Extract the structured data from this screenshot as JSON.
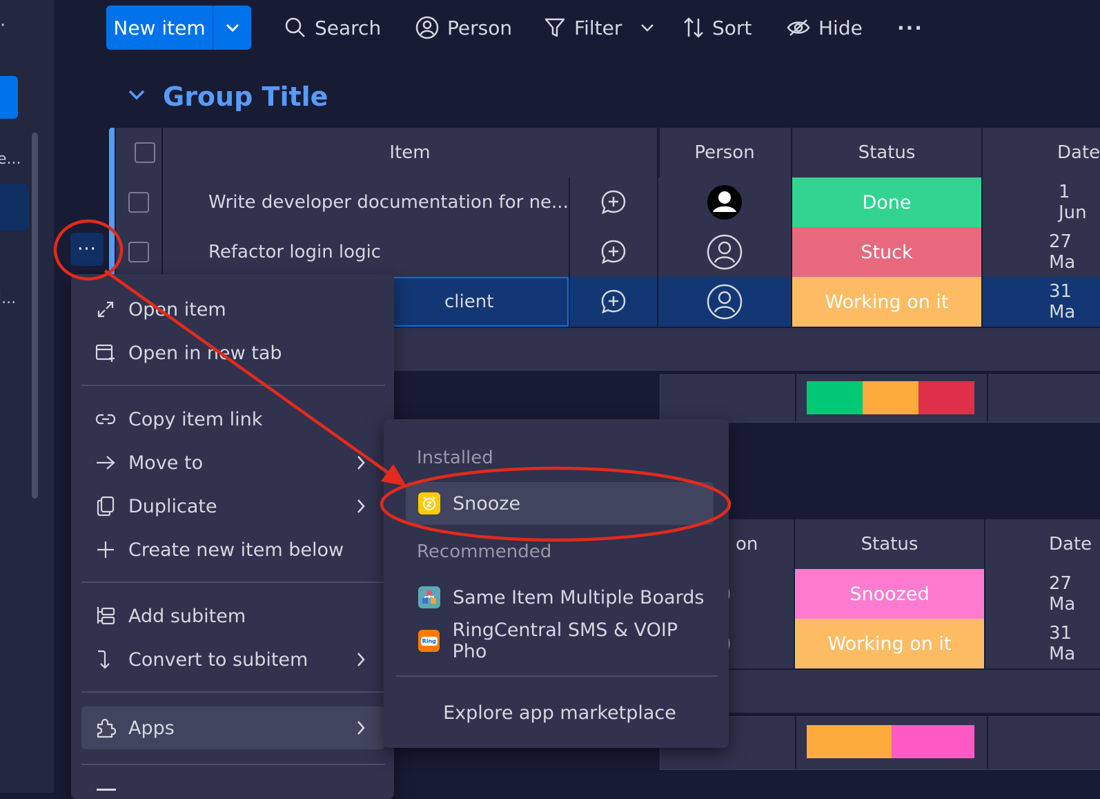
{
  "rail": {
    "txt1": "e...",
    "txt2": "l...",
    "dot": "·"
  },
  "toolbar": {
    "new_item": "New item",
    "search": "Search",
    "person": "Person",
    "filter": "Filter",
    "sort": "Sort",
    "hide": "Hide",
    "more": "···"
  },
  "group": {
    "title": "Group Title"
  },
  "table": {
    "headers": {
      "item": "Item",
      "person": "Person",
      "status": "Status",
      "date": "Date"
    },
    "rows": [
      {
        "item": "Write developer documentation for ne...",
        "status": "Done",
        "status_color": "#33d391",
        "date": "1 Jun"
      },
      {
        "item": "Refactor login logic",
        "status": "Stuck",
        "status_color": "#e8697d",
        "date": "27 Ma"
      },
      {
        "item": "client",
        "status": "Working on it",
        "status_color": "#fdbc64",
        "date": "31 Ma"
      }
    ],
    "summary_colors": [
      "#00c875",
      "#fdab3d",
      "#df2f4a"
    ]
  },
  "table2": {
    "headers": {
      "person": "on",
      "status": "Status",
      "date": "Date"
    },
    "rows": [
      {
        "status": "Snoozed",
        "status_color": "#ff7bd0",
        "date": "27 Ma"
      },
      {
        "status": "Working on it",
        "status_color": "#fdbc64",
        "date": "31 Ma"
      }
    ],
    "summary_colors": [
      "#fdab3d",
      "#ff5ac4"
    ]
  },
  "context_menu": {
    "open_item": "Open item",
    "open_new_tab": "Open in new tab",
    "copy_link": "Copy item link",
    "move_to": "Move to",
    "duplicate": "Duplicate",
    "create_below": "Create new item below",
    "add_subitem": "Add subitem",
    "convert_subitem": "Convert to subitem",
    "apps": "Apps"
  },
  "apps_menu": {
    "installed_header": "Installed",
    "snooze": "Snooze",
    "recommended_header": "Recommended",
    "same_item": "Same Item Multiple Boards",
    "ringcentral": "RingCentral SMS & VOIP Pho",
    "ringcentral_badge": "Ring",
    "explore": "Explore app marketplace"
  },
  "item_menu_button": "···"
}
